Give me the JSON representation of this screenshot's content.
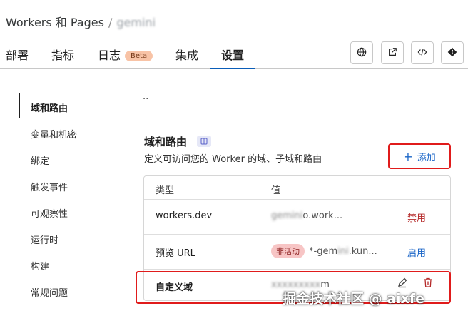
{
  "breadcrumb": {
    "root": "Workers 和 Pages",
    "separator": "/",
    "current": "gemini"
  },
  "tabs": [
    {
      "label": "部署"
    },
    {
      "label": "指标"
    },
    {
      "label": "日志",
      "badge": "Beta"
    },
    {
      "label": "集成"
    },
    {
      "label": "设置",
      "active": true
    }
  ],
  "toolbar_icons": [
    "globe-icon",
    "external-link-icon",
    "code-icon",
    "git-icon"
  ],
  "sidebar": {
    "items": [
      {
        "label": "域和路由",
        "active": true
      },
      {
        "label": "变量和机密"
      },
      {
        "label": "绑定"
      },
      {
        "label": "触发事件"
      },
      {
        "label": "可观察性"
      },
      {
        "label": "运行时"
      },
      {
        "label": "构建"
      },
      {
        "label": "常规问题"
      }
    ]
  },
  "top_mark": "..",
  "section": {
    "title": "域和路由",
    "description": "定义可访问您的 Worker 的域、子域和路由",
    "add_button": "添加"
  },
  "table": {
    "headers": {
      "type": "类型",
      "value": "值"
    },
    "rows": [
      {
        "type": "workers.dev",
        "value_hidden": "gemini",
        "value_suffix": "o.work...",
        "action": "禁用"
      },
      {
        "type": "预览 URL",
        "badge": "非活动",
        "value_prefix": "*-gem",
        "value_hidden": "ini",
        "value_suffix": ".kun...",
        "action": "启用"
      },
      {
        "type": "自定义域",
        "value_hidden": "xxxxxxxxx",
        "value_suffix": "m"
      }
    ]
  },
  "watermark": "掘金技术社区 @ aixfe",
  "colors": {
    "accent": "#1a65c7",
    "highlight": "#e01b1b",
    "disable": "#b52a2a",
    "beta_badge": "#f8c3a6",
    "inactive_badge": "#f7c5c5"
  }
}
